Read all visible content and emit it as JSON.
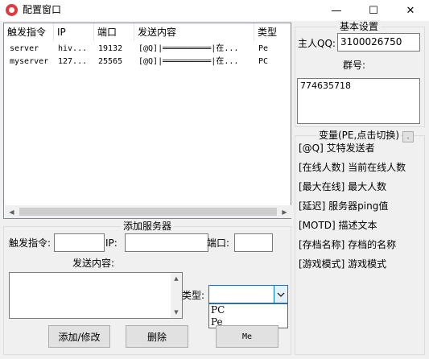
{
  "window": {
    "title": "配置窗口",
    "minimize": "—",
    "maximize": "☐",
    "close": "✕"
  },
  "server_list": {
    "columns": [
      "触发指令",
      "IP",
      "端口",
      "发送内容",
      "类型"
    ],
    "rows": [
      [
        "server",
        "hiv...",
        "19132",
        "[@Q]|══════════|在...",
        "Pe"
      ],
      [
        "myserver",
        "127...",
        "25565",
        "[@Q]|══════════|在...",
        "PC"
      ]
    ]
  },
  "add_server": {
    "title": "添加服务器",
    "trigger_label": "触发指令:",
    "ip_label": "IP:",
    "port_label": "端口:",
    "content_label": "发送内容:",
    "type_label": "类型:",
    "add_button": "添加/修改",
    "delete_button": "删除",
    "me_button": "Me",
    "type_options": [
      "PC",
      "Pe"
    ]
  },
  "basic_settings": {
    "title": "基本设置",
    "owner_label": "主人QQ:",
    "owner_value": "3100026750",
    "group_label": "群号:",
    "group_value": "774635718"
  },
  "variables": {
    "title": "变量(PE,点击切换)",
    "toggle_button": ".",
    "items": [
      "[@Q] 艾特发送者",
      "[在线人数] 当前在线人数",
      "[最大在线] 最大人数",
      "[延迟] 服务器ping值",
      "[MOTD] 描述文本",
      "[存档名称] 存档的名称",
      "[游戏模式] 游戏模式"
    ]
  }
}
